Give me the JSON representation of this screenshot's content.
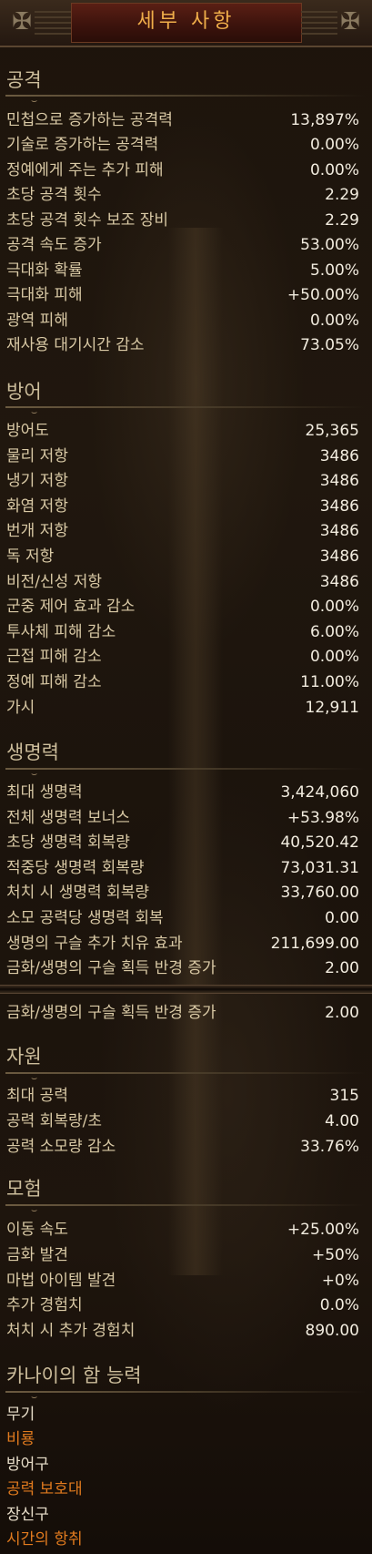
{
  "window": {
    "title": "세부 사항"
  },
  "colors": {
    "title_text": "#f0ae4a",
    "legendary_orange": "#e07a1e",
    "value_text": "#f2ecdf"
  },
  "sections": {
    "attack": {
      "title": "공격",
      "rows": [
        {
          "label": "민첩으로 증가하는 공격력",
          "value": "13,897%"
        },
        {
          "label": "기술로 증가하는 공격력",
          "value": "0.00%"
        },
        {
          "label": "정예에게 주는 추가 피해",
          "value": "0.00%"
        },
        {
          "label": "초당 공격 횟수",
          "value": "2.29"
        },
        {
          "label": "초당 공격 횟수 보조 장비",
          "value": "2.29"
        },
        {
          "label": "공격 속도 증가",
          "value": "53.00%"
        },
        {
          "label": "극대화 확률",
          "value": "5.00%"
        },
        {
          "label": "극대화 피해",
          "value": "+50.00%"
        },
        {
          "label": "광역 피해",
          "value": "0.00%"
        },
        {
          "label": "재사용 대기시간 감소",
          "value": "73.05%"
        }
      ]
    },
    "defense": {
      "title": "방어",
      "rows": [
        {
          "label": "방어도",
          "value": "25,365"
        },
        {
          "label": "물리 저항",
          "value": "3486"
        },
        {
          "label": "냉기 저항",
          "value": "3486"
        },
        {
          "label": "화염 저항",
          "value": "3486"
        },
        {
          "label": "번개 저항",
          "value": "3486"
        },
        {
          "label": "독 저항",
          "value": "3486"
        },
        {
          "label": "비전/신성 저항",
          "value": "3486"
        },
        {
          "label": "군중 제어 효과 감소",
          "value": "0.00%"
        },
        {
          "label": "투사체 피해 감소",
          "value": "6.00%"
        },
        {
          "label": "근접 피해 감소",
          "value": "0.00%"
        },
        {
          "label": "정예 피해 감소",
          "value": "11.00%"
        },
        {
          "label": "가시",
          "value": "12,911"
        }
      ]
    },
    "life": {
      "title": "생명력",
      "rows": [
        {
          "label": "최대 생명력",
          "value": "3,424,060"
        },
        {
          "label": "전체 생명력 보너스",
          "value": "+53.98%"
        },
        {
          "label": "초당 생명력 회복량",
          "value": "40,520.42"
        },
        {
          "label": "적중당 생명력 회복량",
          "value": "73,031.31"
        },
        {
          "label": "처치 시 생명력 회복량",
          "value": "33,760.00"
        },
        {
          "label": "소모 공력당 생명력 회복",
          "value": "0.00"
        },
        {
          "label": "생명의 구슬 추가 치유 효과",
          "value": "211,699.00"
        },
        {
          "label": "금화/생명의 구슬 획득 반경 증가",
          "value": "2.00"
        }
      ]
    },
    "repeat_row": {
      "label": "금화/생명의 구슬 획득 반경 증가",
      "value": "2.00"
    },
    "resource": {
      "title": "자원",
      "rows": [
        {
          "label": "최대 공력",
          "value": "315"
        },
        {
          "label": "공력 회복량/초",
          "value": "4.00"
        },
        {
          "label": "공력 소모량 감소",
          "value": "33.76%"
        }
      ]
    },
    "adventure": {
      "title": "모험",
      "rows": [
        {
          "label": "이동 속도",
          "value": "+25.00%"
        },
        {
          "label": "금화 발견",
          "value": "+50%"
        },
        {
          "label": "마법 아이템 발견",
          "value": "+0%"
        },
        {
          "label": "추가 경험치",
          "value": "0.0%"
        },
        {
          "label": "처치 시 추가 경험치",
          "value": "890.00"
        }
      ]
    },
    "kanai": {
      "title": "카나이의 함 능력",
      "items": [
        {
          "label": "무기",
          "color": "white"
        },
        {
          "label": "비룡",
          "color": "orange"
        },
        {
          "label": "방어구",
          "color": "white"
        },
        {
          "label": "공력 보호대",
          "color": "orange"
        },
        {
          "label": "장신구",
          "color": "white"
        },
        {
          "label": "시간의 항취",
          "color": "orange"
        }
      ]
    }
  }
}
